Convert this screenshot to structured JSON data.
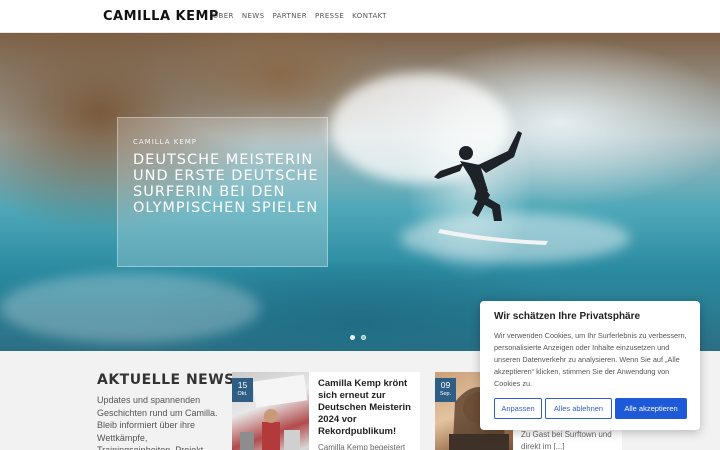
{
  "header": {
    "logo": "CAMILLA KEMP",
    "nav": [
      "ÜBER",
      "NEWS",
      "PARTNER",
      "PRESSE",
      "KONTAKT"
    ]
  },
  "hero": {
    "kicker": "CAMILLA KEMP",
    "title": "DEUTSCHE MEISTERIN UND ERSTE DEUTSCHE SURFERIN BEI DEN OLYMPISCHEN SPIELEN",
    "slide_count": 2,
    "active_slide": 1
  },
  "news": {
    "heading": "AKTUELLE NEWS",
    "intro": "Updates und spannenden Geschichten rund um Camilla. Bleib informiert über ihre Wettkämpfe, Trainingseinheiten, Projekt",
    "cards": [
      {
        "day": "15",
        "month": "Okt.",
        "title": "Camilla Kemp krönt sich erneut zur Deutschen Meisterin 2024 vor Rekordpublikum!",
        "excerpt": "Camilla Kemp begeistert"
      },
      {
        "day": "09",
        "month": "Sep.",
        "text": "Zu Gast bei Surftown und direkt im [...]"
      }
    ]
  },
  "cookie": {
    "title": "Wir schätzen Ihre Privatsphäre",
    "text": "Wir verwenden Cookies, um Ihr Surferlebnis zu verbessern, personalisierte Anzeigen oder Inhalte einzusetzen und unseren Datenverkehr zu analysieren. Wenn Sie auf „Alle akzeptieren“ klicken, stimmen Sie der Anwendung von Cookies zu.",
    "btn_adjust": "Anpassen",
    "btn_reject": "Alles ablehnen",
    "btn_accept": "Alle akzeptieren"
  },
  "colors": {
    "accent": "#1e5ad8",
    "date_badge": "#2f5e85"
  }
}
